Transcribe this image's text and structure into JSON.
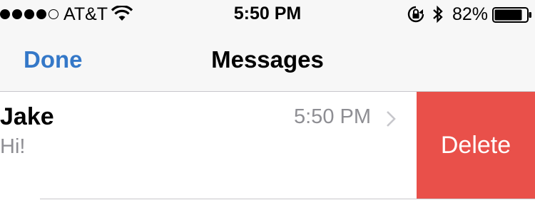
{
  "status_bar": {
    "signal_bars_filled": 4,
    "signal_bars_total": 5,
    "carrier": "AT&T",
    "time": "5:50 PM",
    "battery_percent": "82%",
    "icons": [
      "wifi-icon",
      "rotation-lock-icon",
      "bluetooth-icon",
      "battery-icon"
    ]
  },
  "nav": {
    "done_label": "Done",
    "title": "Messages"
  },
  "conversation": {
    "name": "Jake",
    "time": "5:50 PM",
    "preview": "Hi!",
    "delete_label": "Delete"
  },
  "colors": {
    "accent": "#3478c8",
    "delete": "#e9504a",
    "secondary_text": "#8e8e93",
    "header_bg": "#f7f7f7"
  }
}
